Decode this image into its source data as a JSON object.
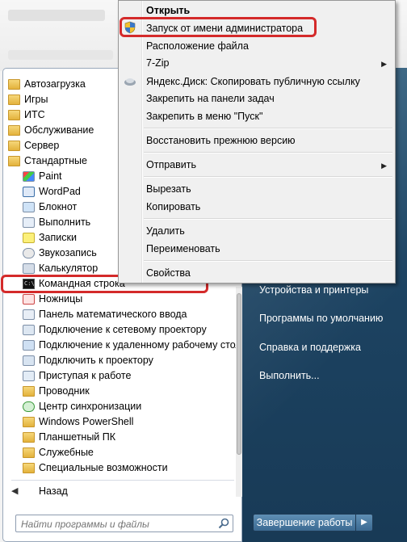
{
  "context_menu": {
    "items": [
      {
        "label": "Открыть",
        "bold": true
      },
      {
        "label": "Запуск от имени администратора",
        "icon": "uac-shield-icon"
      },
      {
        "label": "Расположение файла"
      },
      {
        "label": "7-Zip",
        "submenu": true
      },
      {
        "label": "Яндекс.Диск: Скопировать публичную ссылку",
        "icon": "yandex-disk-icon"
      },
      {
        "label": "Закрепить на панели задач"
      },
      {
        "label": "Закрепить в меню \"Пуск\""
      },
      {
        "label": "Восстановить прежнюю версию"
      },
      {
        "label": "Отправить",
        "submenu": true
      },
      {
        "label": "Вырезать"
      },
      {
        "label": "Копировать"
      },
      {
        "label": "Удалить"
      },
      {
        "label": "Переименовать"
      },
      {
        "label": "Свойства"
      }
    ],
    "submenu_glyph": "▶"
  },
  "programs": [
    {
      "label": "Автозагрузка",
      "icon": "folder-icon"
    },
    {
      "label": "Игры",
      "icon": "folder-icon"
    },
    {
      "label": "ИТС",
      "icon": "folder-icon"
    },
    {
      "label": "Обслуживание",
      "icon": "folder-icon"
    },
    {
      "label": "Сервер",
      "icon": "folder-icon"
    },
    {
      "label": "Стандартные",
      "icon": "folder-icon"
    },
    {
      "label": "Paint",
      "icon": "paint-icon"
    },
    {
      "label": "WordPad",
      "icon": "wordpad-icon"
    },
    {
      "label": "Блокнот",
      "icon": "notepad-icon"
    },
    {
      "label": "Выполнить",
      "icon": "run-icon"
    },
    {
      "label": "Записки",
      "icon": "sticky-notes-icon"
    },
    {
      "label": "Звукозапись",
      "icon": "microphone-icon"
    },
    {
      "label": "Калькулятор",
      "icon": "calculator-icon"
    },
    {
      "label": "Командная строка",
      "icon": "cmd-icon"
    },
    {
      "label": "Ножницы",
      "icon": "scissors-icon"
    },
    {
      "label": "Панель математического ввода",
      "icon": "math-input-icon"
    },
    {
      "label": "Подключение к сетевому проектору",
      "icon": "network-projector-icon"
    },
    {
      "label": "Подключение к удаленному рабочему стол",
      "icon": "remote-desktop-icon"
    },
    {
      "label": "Подключить к проектору",
      "icon": "projector-icon"
    },
    {
      "label": "Приступая к работе",
      "icon": "getting-started-icon"
    },
    {
      "label": "Проводник",
      "icon": "explorer-icon"
    },
    {
      "label": "Центр синхронизации",
      "icon": "sync-center-icon"
    },
    {
      "label": "Windows PowerShell",
      "icon": "folder-icon"
    },
    {
      "label": "Планшетный ПК",
      "icon": "folder-icon"
    },
    {
      "label": "Служебные",
      "icon": "folder-icon"
    },
    {
      "label": "Специальные возможности",
      "icon": "folder-icon"
    }
  ],
  "back_label": "Назад",
  "back_glyph": "◀",
  "search": {
    "placeholder": "Найти программы и файлы"
  },
  "right_pane": {
    "items": [
      "Устройства и принтеры",
      "Программы по умолчанию",
      "Справка и поддержка",
      "Выполнить..."
    ]
  },
  "shutdown": {
    "label": "Завершение работы",
    "arrow": "▶"
  },
  "cmd_icon_text": "C:\\",
  "highlight_color": "#d42a2a"
}
